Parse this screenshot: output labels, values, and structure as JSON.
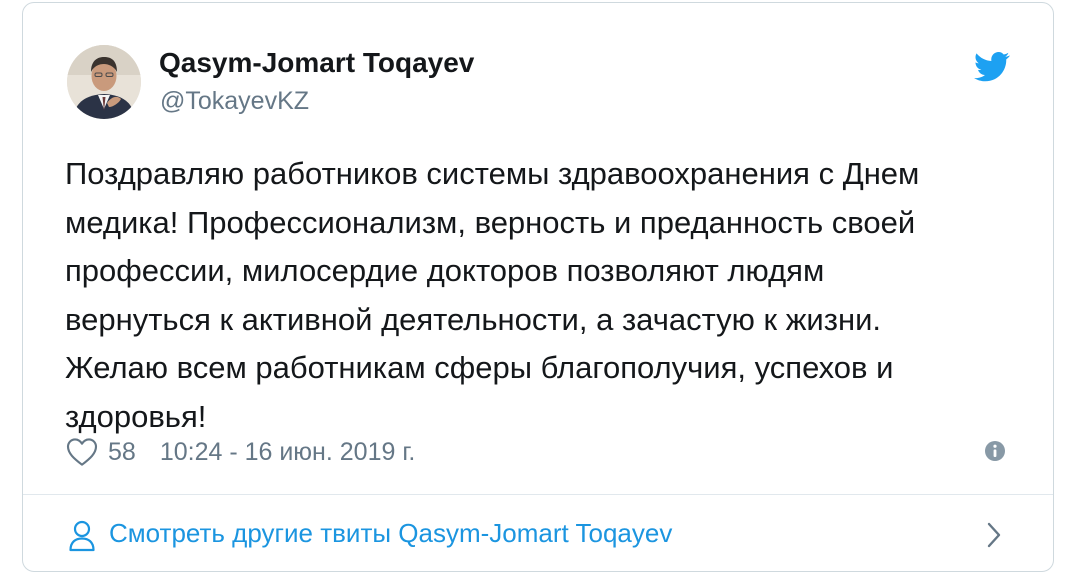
{
  "tweet": {
    "author_name": "Qasym-Jomart Toqayev",
    "author_handle": "@TokayevKZ",
    "text": "Поздравляю работников системы здравоохранения с Днем\nмедика! Профессионализм, верность и преданность своей\nпрофессии, милосердие докторов позволяют людям\nвернуться к активной деятельности, а зачастую к жизни.\nЖелаю всем работникам сферы благополучия, успехов и\nздоровья!",
    "likes": "58",
    "timestamp": "10:24 - 16 июн. 2019 г."
  },
  "footer": {
    "more_tweets_label": "Смотреть другие твиты Qasym-Jomart Toqayev"
  },
  "icons": {
    "brand": "twitter-bird-icon",
    "like": "heart-icon",
    "info": "info-icon",
    "profile": "person-icon",
    "next": "chevron-right-icon"
  },
  "colors": {
    "twitter_blue": "#1da1f2",
    "link_blue": "#1b95e0",
    "text_primary": "#14171a",
    "text_secondary": "#657786",
    "border": "#cfd9de"
  }
}
